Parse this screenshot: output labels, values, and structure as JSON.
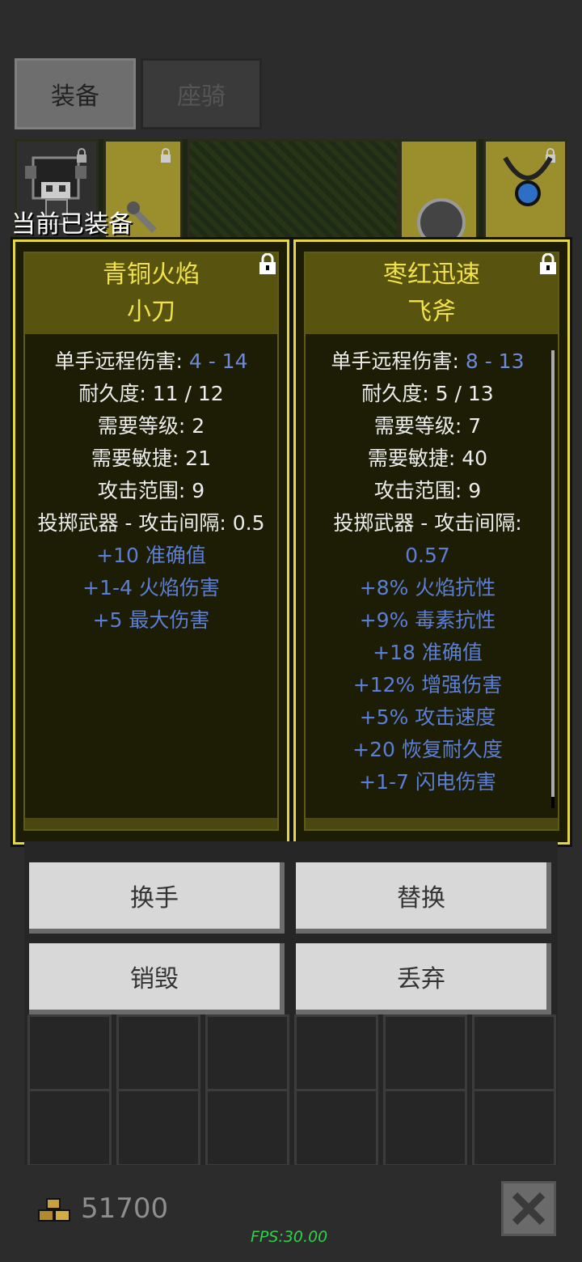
{
  "tabs": [
    {
      "label": "装备",
      "active": true
    },
    {
      "label": "座骑",
      "active": false
    }
  ],
  "equipped_label": "当前已装备",
  "cards": [
    {
      "title_line1": "青铜火焰",
      "title_line2": "小刀",
      "stats": [
        {
          "label": "单手远程伤害: ",
          "value": "4 - 14"
        },
        {
          "label": "耐久度: 11 / 12"
        },
        {
          "label": "需要等级: 2"
        },
        {
          "label": "需要敏捷: 21"
        },
        {
          "label": "攻击范围: 9"
        },
        {
          "label": "投掷武器 - 攻击间隔: 0.5"
        }
      ],
      "bonuses": [
        "+10 准确值",
        "+1-4 火焰伤害",
        "+5 最大伤害"
      ]
    },
    {
      "title_line1": "枣红迅速",
      "title_line2": "飞斧",
      "stats": [
        {
          "label": "单手远程伤害: ",
          "value": "8 - 13"
        },
        {
          "label": "耐久度: 5 / 13"
        },
        {
          "label": "需要等级: 7"
        },
        {
          "label": "需要敏捷: 40"
        },
        {
          "label": "攻击范围: 9"
        },
        {
          "label": "投掷武器 - 攻击间隔:"
        }
      ],
      "interval_value": "0.57",
      "bonuses": [
        "+8% 火焰抗性",
        "+9% 毒素抗性",
        "+18 准确值",
        "+12% 增强伤害",
        "+5% 攻击速度",
        "+20 恢复耐久度",
        "+1-7 闪电伤害"
      ]
    }
  ],
  "actions": {
    "swap_hand": "换手",
    "replace": "替换",
    "destroy": "销毁",
    "drop": "丢弃"
  },
  "gold": "51700",
  "fps": "FPS:30.00",
  "colors": {
    "card_border": "#e5d742",
    "title_text": "#f1e24a",
    "bonus_text": "#5b7fd6"
  }
}
